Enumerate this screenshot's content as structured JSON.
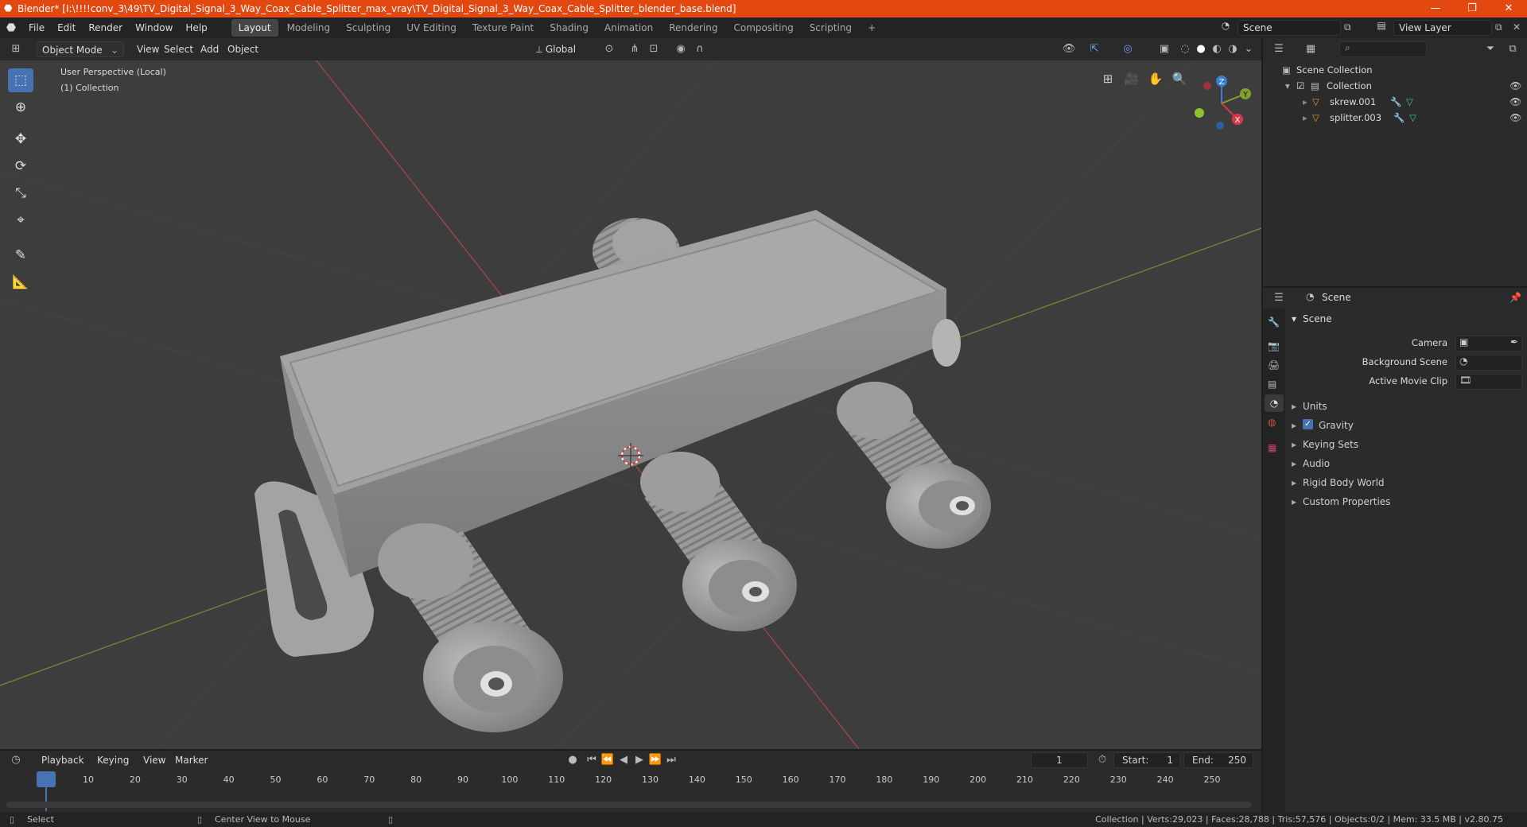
{
  "window": {
    "title": "Blender* [I:\\!!!!conv_3\\49\\TV_Digital_Signal_3_Way_Coax_Cable_Splitter_max_vray\\TV_Digital_Signal_3_Way_Coax_Cable_Splitter_blender_base.blend]"
  },
  "menu": {
    "items": [
      "File",
      "Edit",
      "Render",
      "Window",
      "Help"
    ]
  },
  "workspaces": [
    "Layout",
    "Modeling",
    "Sculpting",
    "UV Editing",
    "Texture Paint",
    "Shading",
    "Animation",
    "Rendering",
    "Compositing",
    "Scripting"
  ],
  "topright": {
    "scene": "Scene",
    "view_layer": "View Layer"
  },
  "viewport_header": {
    "mode": "Object Mode",
    "menus": [
      "View",
      "Select",
      "Add",
      "Object"
    ],
    "orientation": "Global"
  },
  "overlay": {
    "perspective": "User Perspective (Local)",
    "collection": "(1) Collection"
  },
  "gizmo": {
    "x": "X",
    "y": "Y",
    "z": "Z"
  },
  "outliner": {
    "root": "Scene Collection",
    "collection": "Collection",
    "objects": [
      "skrew.001",
      "splitter.003"
    ]
  },
  "properties": {
    "header": "Scene",
    "panel": "Scene",
    "camera_label": "Camera",
    "bg_scene_label": "Background Scene",
    "movie_clip_label": "Active Movie Clip",
    "sections": [
      "Units",
      "Gravity",
      "Keying Sets",
      "Audio",
      "Rigid Body World",
      "Custom Properties"
    ]
  },
  "timeline": {
    "menus": [
      "Playback",
      "Keying",
      "View",
      "Marker"
    ],
    "current_frame": "1",
    "start_label": "Start:",
    "start": "1",
    "end_label": "End:",
    "end": "250",
    "ticks": [
      "1",
      "10",
      "20",
      "30",
      "40",
      "50",
      "60",
      "70",
      "80",
      "90",
      "100",
      "110",
      "120",
      "130",
      "140",
      "150",
      "160",
      "170",
      "180",
      "190",
      "200",
      "210",
      "220",
      "230",
      "240",
      "250"
    ]
  },
  "status": {
    "left": "Select",
    "middle": "Center View to Mouse",
    "right": "Collection | Verts:29,023 | Faces:28,788 | Tris:57,576 | Objects:0/2 | Mem: 33.5 MB | v2.80.75"
  },
  "colors": {
    "accent": "#4772b3",
    "titlebar": "#e2480f",
    "object_icon": "#e8913a"
  }
}
